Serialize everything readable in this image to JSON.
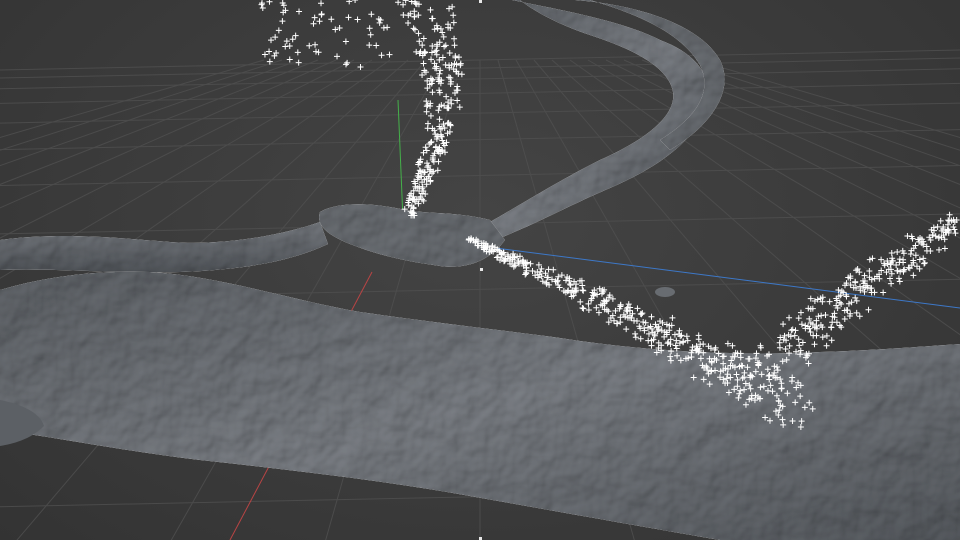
{
  "viewport": {
    "type": "3d-viewport",
    "background": "#3a3a3a",
    "grid_color": "#4f4f4f",
    "axis_colors": {
      "x": "#c04545",
      "y": "#45b04a",
      "z": "#3d78c8"
    },
    "mesh_color": "#6e7277",
    "particle_color": "#ffffff",
    "particle_glyph": "+"
  }
}
